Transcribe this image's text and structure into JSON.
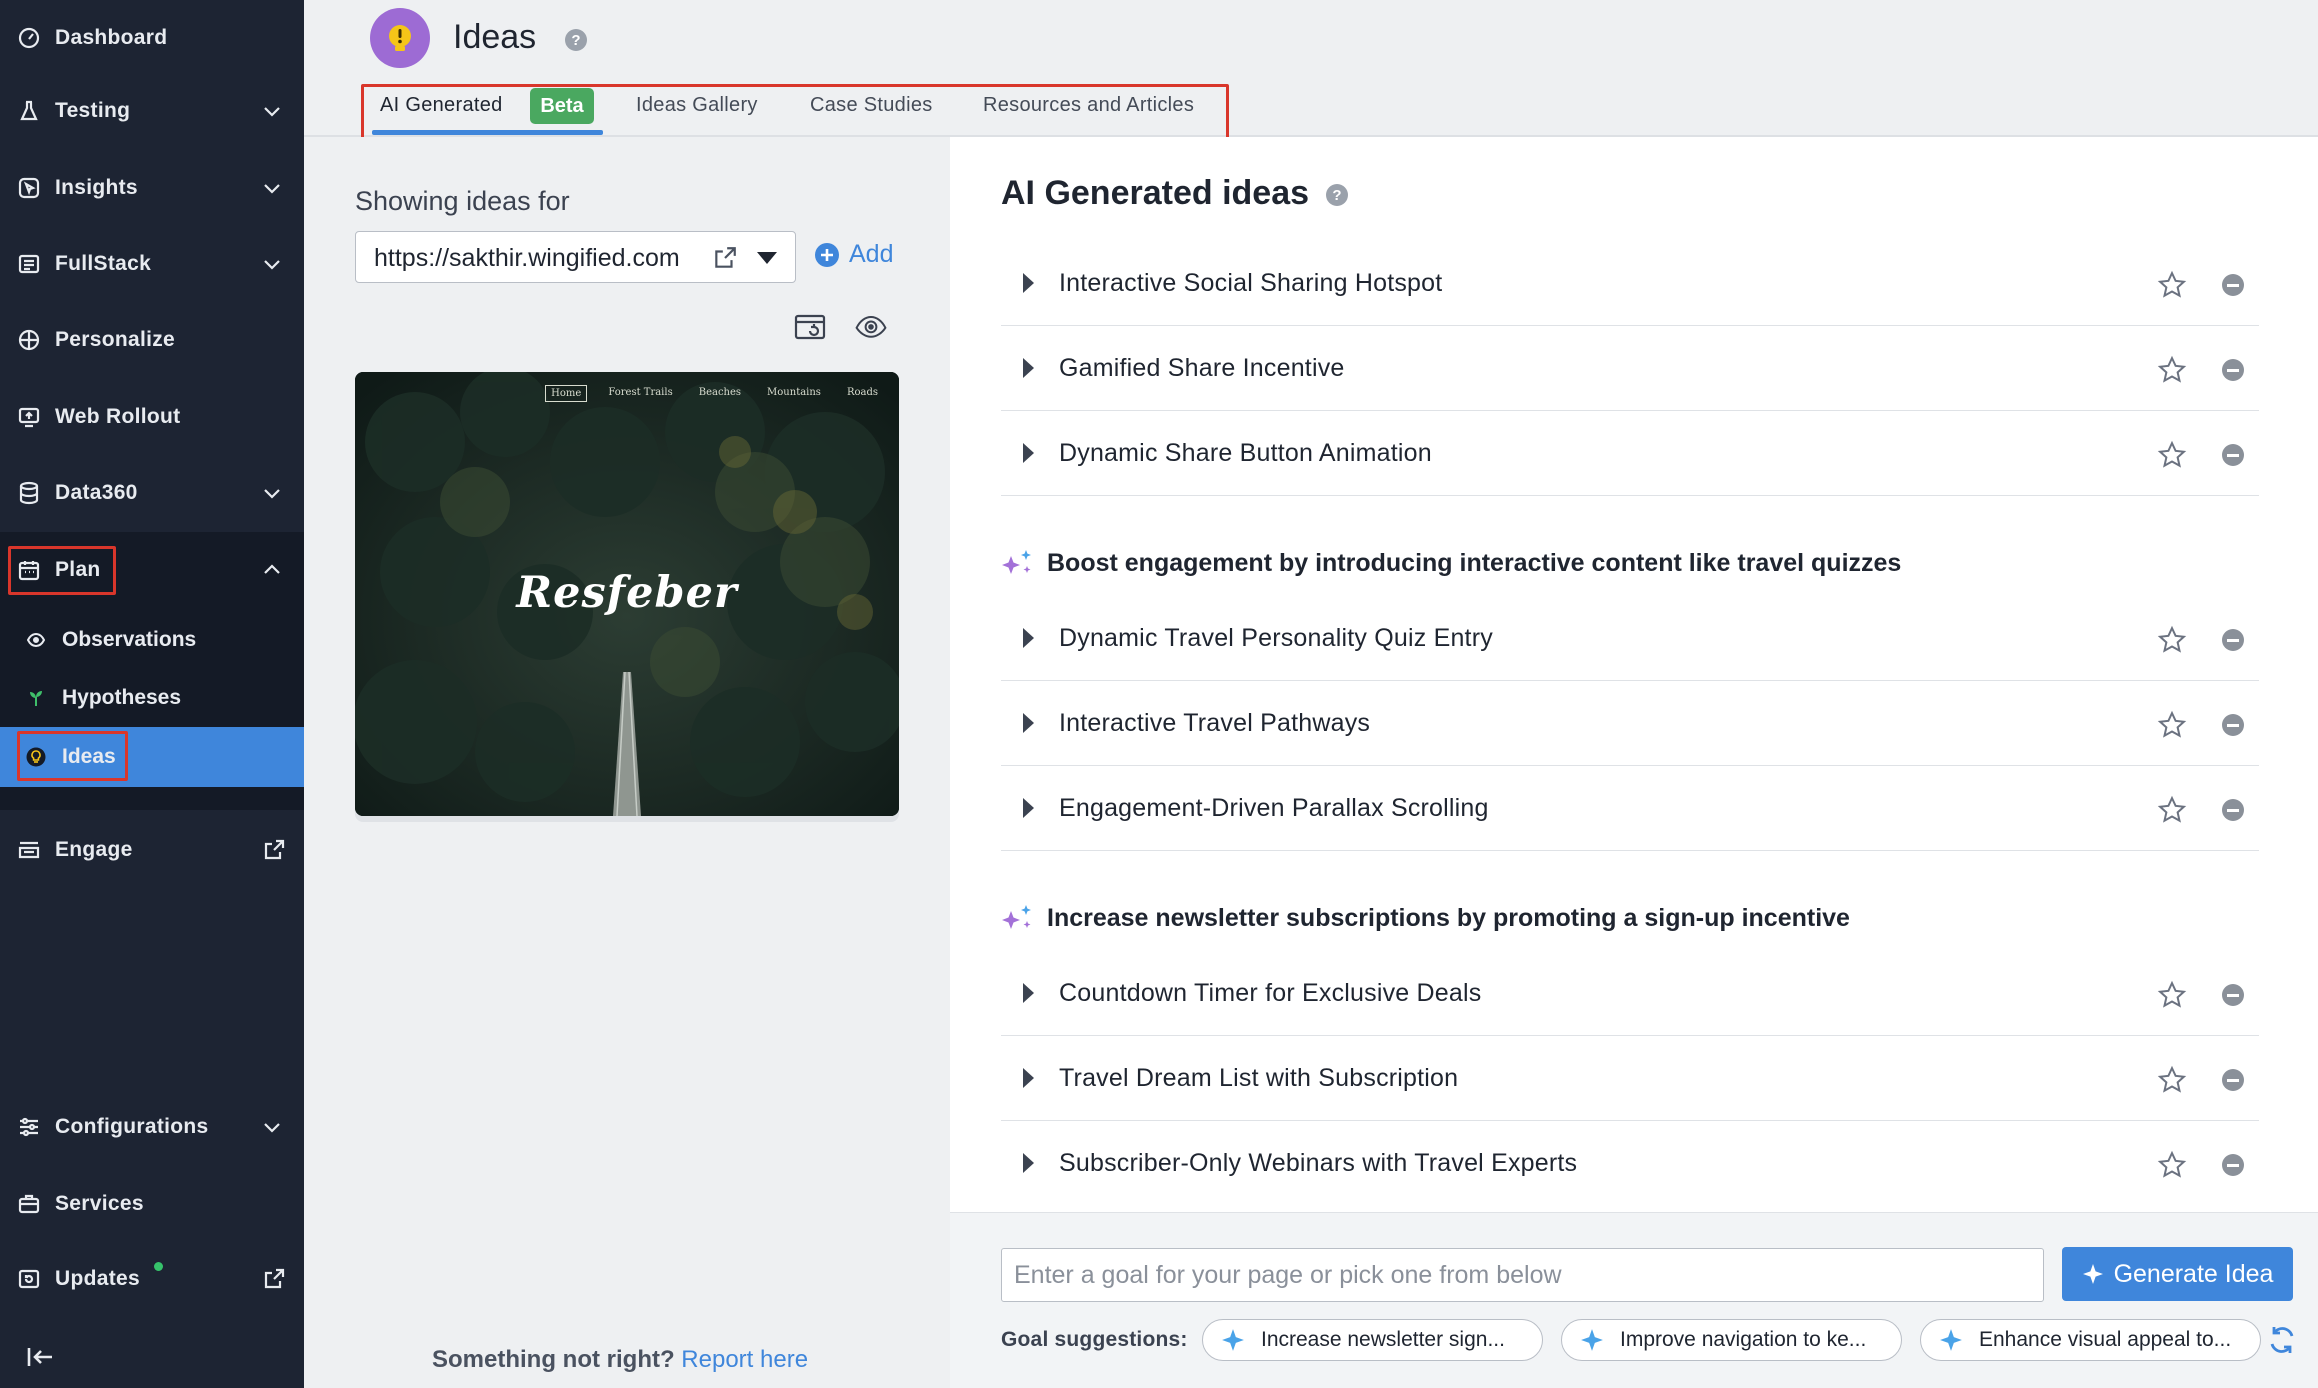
{
  "sidebar": {
    "items": [
      {
        "label": "Dashboard",
        "icon": "dashboard-icon"
      },
      {
        "label": "Testing",
        "icon": "flask-icon"
      },
      {
        "label": "Insights",
        "icon": "cursor-box-icon"
      },
      {
        "label": "FullStack",
        "icon": "list-box-icon"
      },
      {
        "label": "Personalize",
        "icon": "crosshair-icon"
      },
      {
        "label": "Web Rollout",
        "icon": "rollout-icon"
      },
      {
        "label": "Data360",
        "icon": "database-icon"
      },
      {
        "label": "Plan",
        "icon": "calendar-icon"
      },
      {
        "label": "Engage",
        "icon": "engage-icon"
      },
      {
        "label": "Configurations",
        "icon": "sliders-icon"
      },
      {
        "label": "Services",
        "icon": "briefcase-icon"
      },
      {
        "label": "Updates",
        "icon": "updates-icon"
      }
    ],
    "plan_subitems": [
      {
        "label": "Observations",
        "icon": "eye-icon"
      },
      {
        "label": "Hypotheses",
        "icon": "sprout-icon"
      },
      {
        "label": "Ideas",
        "icon": "bulb-icon"
      }
    ],
    "collapse_icon": "collapse-left-icon"
  },
  "header": {
    "title": "Ideas",
    "help": "?",
    "tabs": [
      {
        "label": "AI Generated",
        "badge": "Beta"
      },
      {
        "label": "Ideas Gallery"
      },
      {
        "label": "Case Studies"
      },
      {
        "label": "Resources and Articles"
      }
    ]
  },
  "left": {
    "showing_label": "Showing ideas for",
    "url": "https://sakthir.wingified.com",
    "add_label": "Add",
    "preview": {
      "nav": [
        "Home",
        "Forest Trails",
        "Beaches",
        "Mountains",
        "Roads"
      ],
      "brand": "Resfeber"
    },
    "footer_text": "Something not right?",
    "footer_link": "Report here"
  },
  "right": {
    "title": "AI Generated ideas",
    "help": "?",
    "groups": [
      {
        "heading": "",
        "ideas": [
          "Interactive Social Sharing Hotspot",
          "Gamified Share Incentive",
          "Dynamic Share Button Animation"
        ]
      },
      {
        "heading": "Boost engagement by introducing interactive content like travel quizzes",
        "ideas": [
          "Dynamic Travel Personality Quiz Entry",
          "Interactive Travel Pathways",
          "Engagement-Driven Parallax Scrolling"
        ]
      },
      {
        "heading": "Increase newsletter subscriptions by promoting a sign-up incentive",
        "ideas": [
          "Countdown Timer for Exclusive Deals",
          "Travel Dream List with Subscription",
          "Subscriber-Only Webinars with Travel Experts"
        ]
      }
    ]
  },
  "bottom": {
    "input_placeholder": "Enter a goal for your page or pick one from below",
    "generate_label": "Generate Idea",
    "suggestions_label": "Goal suggestions:",
    "suggestions": [
      "Increase newsletter sign...",
      "Improve navigation to ke...",
      "Enhance visual appeal to..."
    ]
  },
  "colors": {
    "sidebar_bg": "#1d2433",
    "accent": "#3f86db",
    "beta": "#4aa860",
    "highlight_box": "#d9362b"
  }
}
